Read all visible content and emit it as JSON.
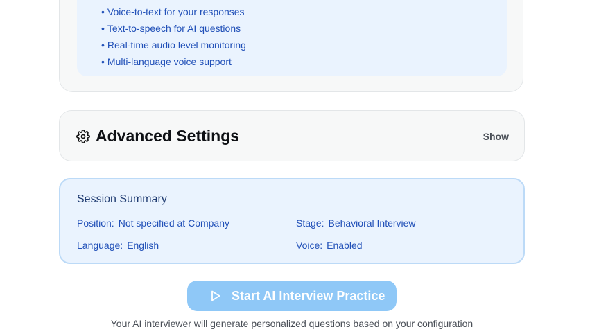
{
  "voice_features": {
    "items": [
      "Voice-to-text for your responses",
      "Text-to-speech for AI questions",
      "Real-time audio level monitoring",
      "Multi-language voice support"
    ],
    "bullet": "•"
  },
  "advanced_settings": {
    "title": "Advanced Settings",
    "toggle_label": "Show",
    "icon": "gear-icon"
  },
  "session_summary": {
    "title": "Session Summary",
    "position_label": "Position:",
    "position_value": "Not specified at Company",
    "stage_label": "Stage:",
    "stage_value": "Behavioral Interview",
    "language_label": "Language:",
    "language_value": "English",
    "voice_label": "Voice:",
    "voice_value": "Enabled"
  },
  "start_button": {
    "label": "Start AI Interview Practice",
    "icon": "play-icon",
    "disabled": true
  },
  "footnote": "Your AI interviewer will generate personalized questions based on your configuration",
  "colors": {
    "accent_blue": "#2150b8",
    "summary_bg": "#eaf3fe",
    "button_bg": "#8fc8f7"
  }
}
